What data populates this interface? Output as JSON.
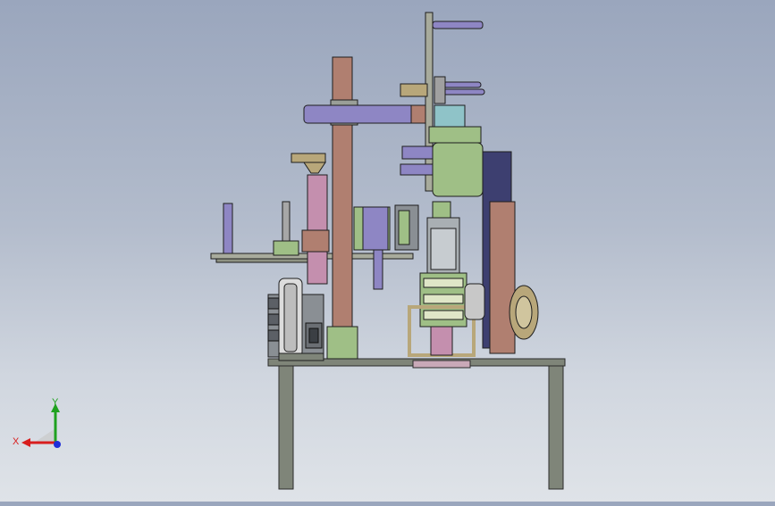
{
  "viewport": {
    "background_top": "#9aa6bd",
    "background_bottom": "#dfe3e8"
  },
  "triad": {
    "x_label": "X",
    "y_label": "Y",
    "x_color": "#d81e1e",
    "y_color": "#1fa11f",
    "z_color": "#1f2ed8"
  },
  "model_colors": {
    "frame": "#7e8478",
    "tan": "#b8a77a",
    "brown_pink": "#b07f70",
    "pink": "#c48fae",
    "lavender": "#8e86c4",
    "green": "#9fbf86",
    "gray": "#9a9f98",
    "navy": "#3d3f70"
  }
}
